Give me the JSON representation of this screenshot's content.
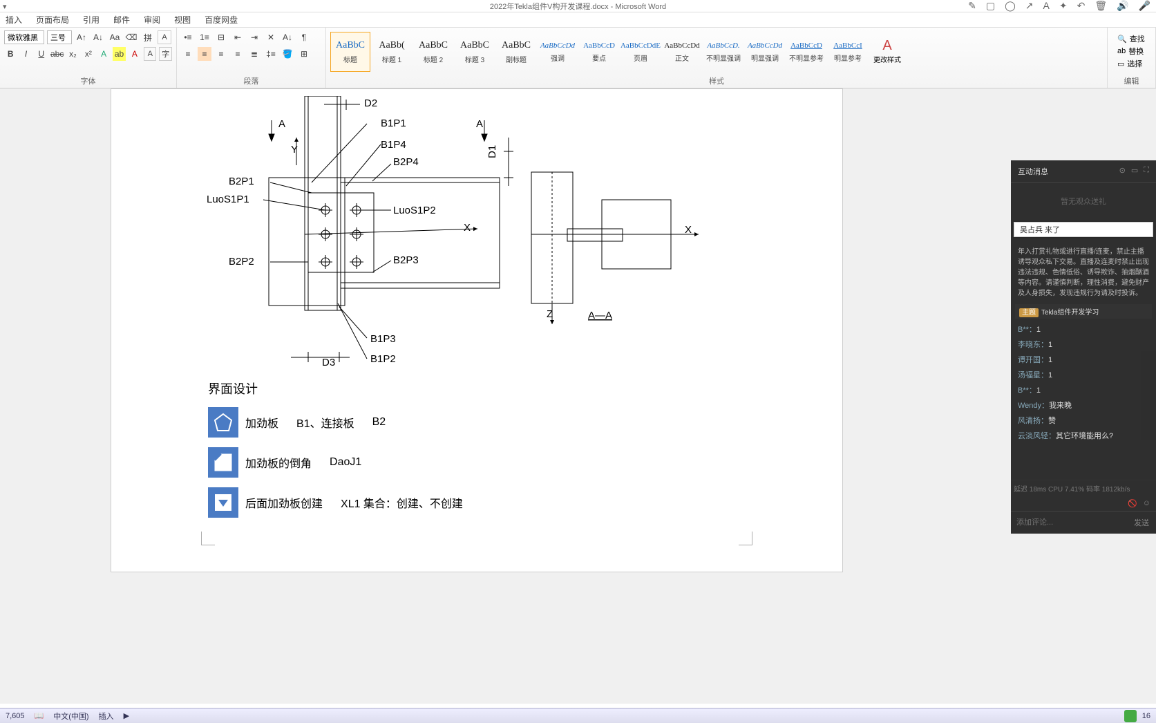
{
  "title": "2022年Tekla组件V构开发课程.docx - Microsoft Word",
  "menus": [
    "插入",
    "页面布局",
    "引用",
    "邮件",
    "审阅",
    "视图",
    "百度网盘"
  ],
  "font": {
    "name": "微软雅黑",
    "size": "三号"
  },
  "ribbon_groups": {
    "font": "字体",
    "para": "段落",
    "styles": "样式",
    "edit": "编辑"
  },
  "styles": [
    {
      "preview": "AaBbC",
      "name": "标题",
      "cls": "selected"
    },
    {
      "preview": "AaBb(",
      "name": "标题 1",
      "cls": "black"
    },
    {
      "preview": "AaBbC",
      "name": "标题 2",
      "cls": "black"
    },
    {
      "preview": "AaBbC",
      "name": "标题 3",
      "cls": "black"
    },
    {
      "preview": "AaBbC",
      "name": "副标题",
      "cls": "black"
    },
    {
      "preview": "AaBbCcDd",
      "name": "强调",
      "cls": "small italic"
    },
    {
      "preview": "AaBbCcD",
      "name": "要点",
      "cls": "small"
    },
    {
      "preview": "AaBbCcDdE",
      "name": "页眉",
      "cls": "small"
    },
    {
      "preview": "AaBbCcDd",
      "name": "正文",
      "cls": "small black"
    },
    {
      "preview": "AaBbCcD.",
      "name": "不明显强调",
      "cls": "small italic"
    },
    {
      "preview": "AaBbCcDd",
      "name": "明显强调",
      "cls": "small italic"
    },
    {
      "preview": "AaBbCcD",
      "name": "不明显参考",
      "cls": "small under"
    },
    {
      "preview": "AaBbCcI",
      "name": "明显参考",
      "cls": "small under"
    }
  ],
  "change_styles": "更改样式",
  "edit": {
    "find": "查找",
    "replace": "替换",
    "select": "选择"
  },
  "drawing_labels": {
    "D2": "D2",
    "D1": "D1",
    "D3": "D3",
    "A1": "A",
    "A2": "A",
    "Y": "Y",
    "X": "X",
    "X2": "X",
    "Z": "Z",
    "AA": "A—A",
    "B1P1": "B1P1",
    "B1P2": "B1P2",
    "B1P3": "B1P3",
    "B1P4": "B1P4",
    "B2P1": "B2P1",
    "B2P2": "B2P2",
    "B2P3": "B2P3",
    "B2P4": "B2P4",
    "LuoS1P1": "LuoS1P1",
    "LuoS1P2": "LuoS1P2"
  },
  "doc": {
    "heading": "界面设计",
    "line1_a": "加劲板",
    "line1_b": "B1、连接板",
    "line1_c": "B2",
    "line2_a": "加劲板的倒角",
    "line2_b": "DaoJ1",
    "line3_a": "后面加劲板创建",
    "line3_b": "XL1  集合：创建、不创建"
  },
  "chat": {
    "title": "互动消息",
    "gift_placeholder": "暂无观众送礼",
    "popup": "吴占兵 来了",
    "notice": "年入打赏礼物或进行直播/连麦，禁止主播诱导观众私下交易。直播及连麦时禁止出现违法违规、色情低俗、诱导欺诈、抽烟酗酒等内容。请谨慎判断，理性消费，避免财产及人身损失，发现违规行为请及时投诉。",
    "topic_tag": "主题",
    "topic": "Tekla组件开发学习",
    "msgs": [
      {
        "u": "B**：",
        "t": "1"
      },
      {
        "u": "李晓东：",
        "t": "1"
      },
      {
        "u": "谭开国：",
        "t": "1"
      },
      {
        "u": "汤福星：",
        "t": "1"
      },
      {
        "u": "B**：",
        "t": "1"
      },
      {
        "u": "Wendy：",
        "t": "我来晚"
      },
      {
        "u": "风清扬：",
        "t": "赞"
      },
      {
        "u": "云淡风轻：",
        "t": "其它环境能用么?"
      }
    ],
    "stats": "延迟 18ms    CPU 7.41%    码率 1812kb/s",
    "input_ph": "添加评论...",
    "send": "发送"
  },
  "status": {
    "count": "7,605",
    "lang": "中文(中国)",
    "mode": "插入",
    "zoom": "16"
  }
}
